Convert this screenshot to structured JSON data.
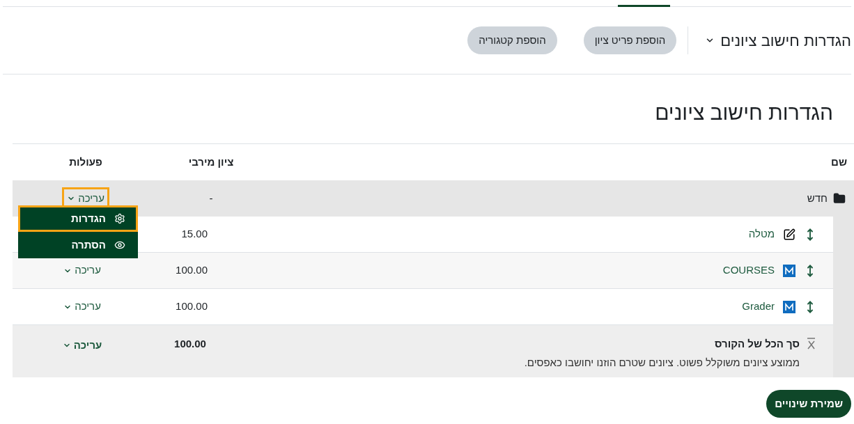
{
  "header": {
    "title": "הגדרות חישוב ציונים",
    "buttons": [
      "הוספת פריט ציון",
      "הוספת קטגוריה"
    ]
  },
  "heading": "הגדרות חישוב ציונים",
  "table": {
    "columns": [
      "שם",
      "ציון מירבי",
      "פעולות"
    ],
    "category": {
      "name": "חדש",
      "max_grade": "-",
      "action": {
        "label": "עריכה",
        "highlighted": true
      },
      "menu": [
        {
          "kind": "settings",
          "label": "הגדרות",
          "highlighted": true
        },
        {
          "kind": "hide",
          "label": "הסתרה",
          "highlighted": false
        }
      ]
    },
    "rows": [
      {
        "kind": "assignment",
        "name": "מטלה",
        "max_grade": "15.00"
      },
      {
        "kind": "module",
        "name": "COURSES",
        "max_grade": "100.00",
        "action": "עריכה"
      },
      {
        "kind": "module",
        "name": "Grader",
        "max_grade": "100.00",
        "action": "עריכה"
      }
    ],
    "total": {
      "name": "סך הכל של הקורס",
      "description": "ממוצע ציונים משוקלל פשוט. ציונים שטרם הוזנו יחושבו כאפסים.",
      "max_grade": "100.00",
      "action": "עריכה"
    }
  },
  "save_button": "שמירת שינויים"
}
